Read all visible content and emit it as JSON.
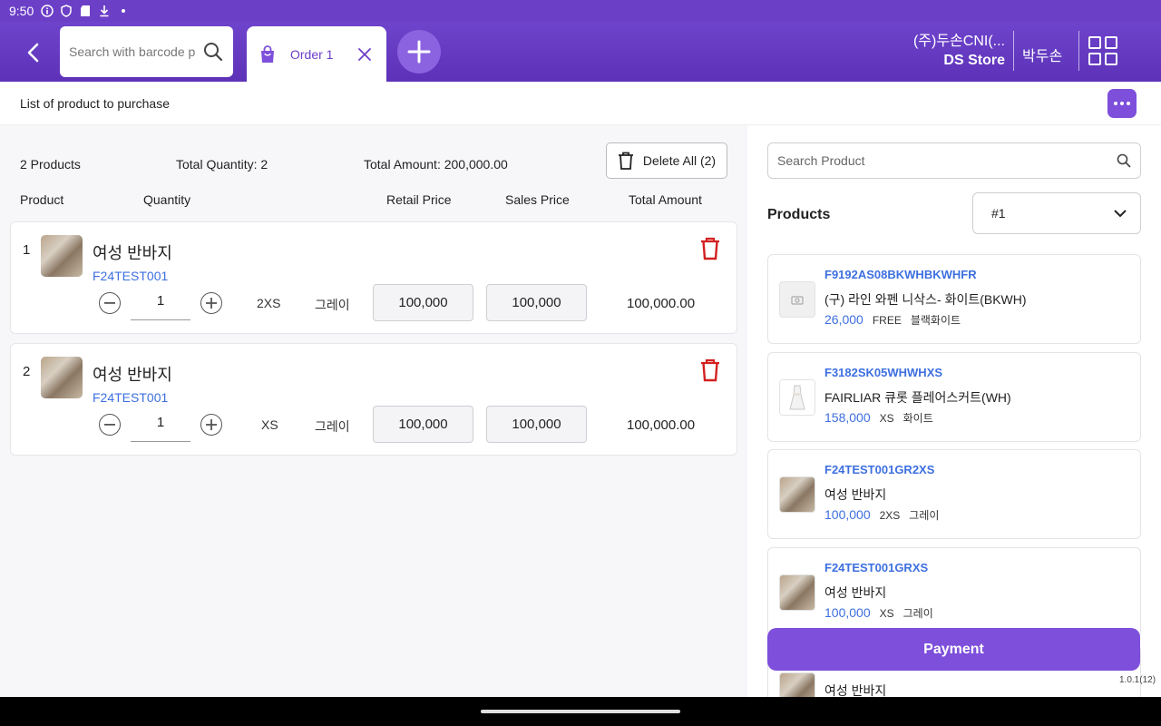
{
  "status_bar": {
    "time": "9:50"
  },
  "header": {
    "barcode_search_placeholder": "Search with barcode product",
    "order_tab_label": "Order 1",
    "company_name": "(주)두손CNI(...",
    "store_name": "DS Store",
    "user_name": "박두손"
  },
  "subheader": {
    "title": "List of product to purchase"
  },
  "summary": {
    "products_count": "2 Products",
    "total_quantity": "Total Quantity: 2",
    "total_amount": "Total Amount: 200,000.00",
    "delete_all_label": "Delete All (2)"
  },
  "columns": {
    "product": "Product",
    "quantity": "Quantity",
    "retail_price": "Retail Price",
    "sales_price": "Sales Price",
    "total_amount": "Total Amount"
  },
  "cart_items": [
    {
      "index": "1",
      "name": "여성 반바지",
      "code": "F24TEST001",
      "quantity": "1",
      "size": "2XS",
      "color": "그레이",
      "retail_price": "100,000",
      "sales_price": "100,000",
      "total": "100,000.00"
    },
    {
      "index": "2",
      "name": "여성 반바지",
      "code": "F24TEST001",
      "quantity": "1",
      "size": "XS",
      "color": "그레이",
      "retail_price": "100,000",
      "sales_price": "100,000",
      "total": "100,000.00"
    }
  ],
  "product_panel": {
    "search_placeholder": "Search Product",
    "products_label": "Products",
    "dropdown_value": "#1",
    "items": [
      {
        "code": "F9192AS08BKWHBKWHFR",
        "name": "(구) 라인 와펜 니삭스- 화이트(BKWH)",
        "price": "26,000",
        "size": "FREE",
        "color": "블랙화이트",
        "thumb": "placeholder-icon"
      },
      {
        "code": "F3182SK05WHWHXS",
        "name": "FAIRLIAR 큐롯 플레어스커트(WH)",
        "price": "158,000",
        "size": "XS",
        "color": "화이트",
        "thumb": "skirt-image"
      },
      {
        "code": "F24TEST001GR2XS",
        "name": "여성 반바지",
        "price": "100,000",
        "size": "2XS",
        "color": "그레이",
        "thumb": "shorts-image"
      },
      {
        "code": "F24TEST001GRXS",
        "name": "여성 반바지",
        "price": "100,000",
        "size": "XS",
        "color": "그레이",
        "thumb": "shorts-image"
      },
      {
        "code": "",
        "name": "여성 반바지",
        "price": "",
        "size": "",
        "color": "",
        "thumb": "shorts-image"
      }
    ],
    "payment_label": "Payment",
    "version": "1.0.1(12)"
  },
  "colors": {
    "primary": "#6c3fc7",
    "accent_button": "#7d4fdb",
    "link_blue": "#3d6fe0",
    "delete_red": "#d32020"
  }
}
